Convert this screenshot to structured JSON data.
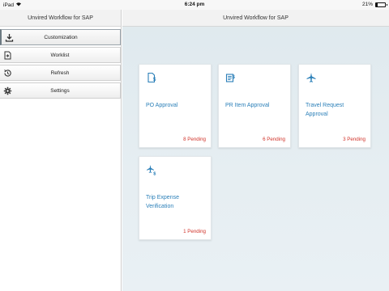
{
  "statusbar": {
    "device": "iPad",
    "time": "6:24 pm",
    "battery": "21%",
    "battery_level": 0.21
  },
  "sidebar": {
    "title": "Unvired Workflow for SAP",
    "items": [
      {
        "label": "Customization",
        "icon": "download-icon",
        "active": true
      },
      {
        "label": "Worklist",
        "icon": "document-arrow-icon",
        "active": false
      },
      {
        "label": "Refresh",
        "icon": "clock-refresh-icon",
        "active": false
      },
      {
        "label": "Settings",
        "icon": "gear-icon",
        "active": false
      }
    ]
  },
  "main": {
    "title": "Unvired Workflow for SAP",
    "tiles": [
      {
        "title": "PO Approval",
        "count": "8 Pending",
        "icon": "document-dollar-icon"
      },
      {
        "title": "PR Item Approval",
        "count": "6 Pending",
        "icon": "list-dollar-icon"
      },
      {
        "title": "Travel Request Approval",
        "count": "3 Pending",
        "icon": "airplane-icon"
      },
      {
        "title": "Trip Expense Verification",
        "count": "1 Pending",
        "icon": "airplane-dollar-icon"
      }
    ]
  },
  "colors": {
    "accent": "#2a7fb8",
    "pending": "#d0332a",
    "background": "#e3ecf0"
  }
}
